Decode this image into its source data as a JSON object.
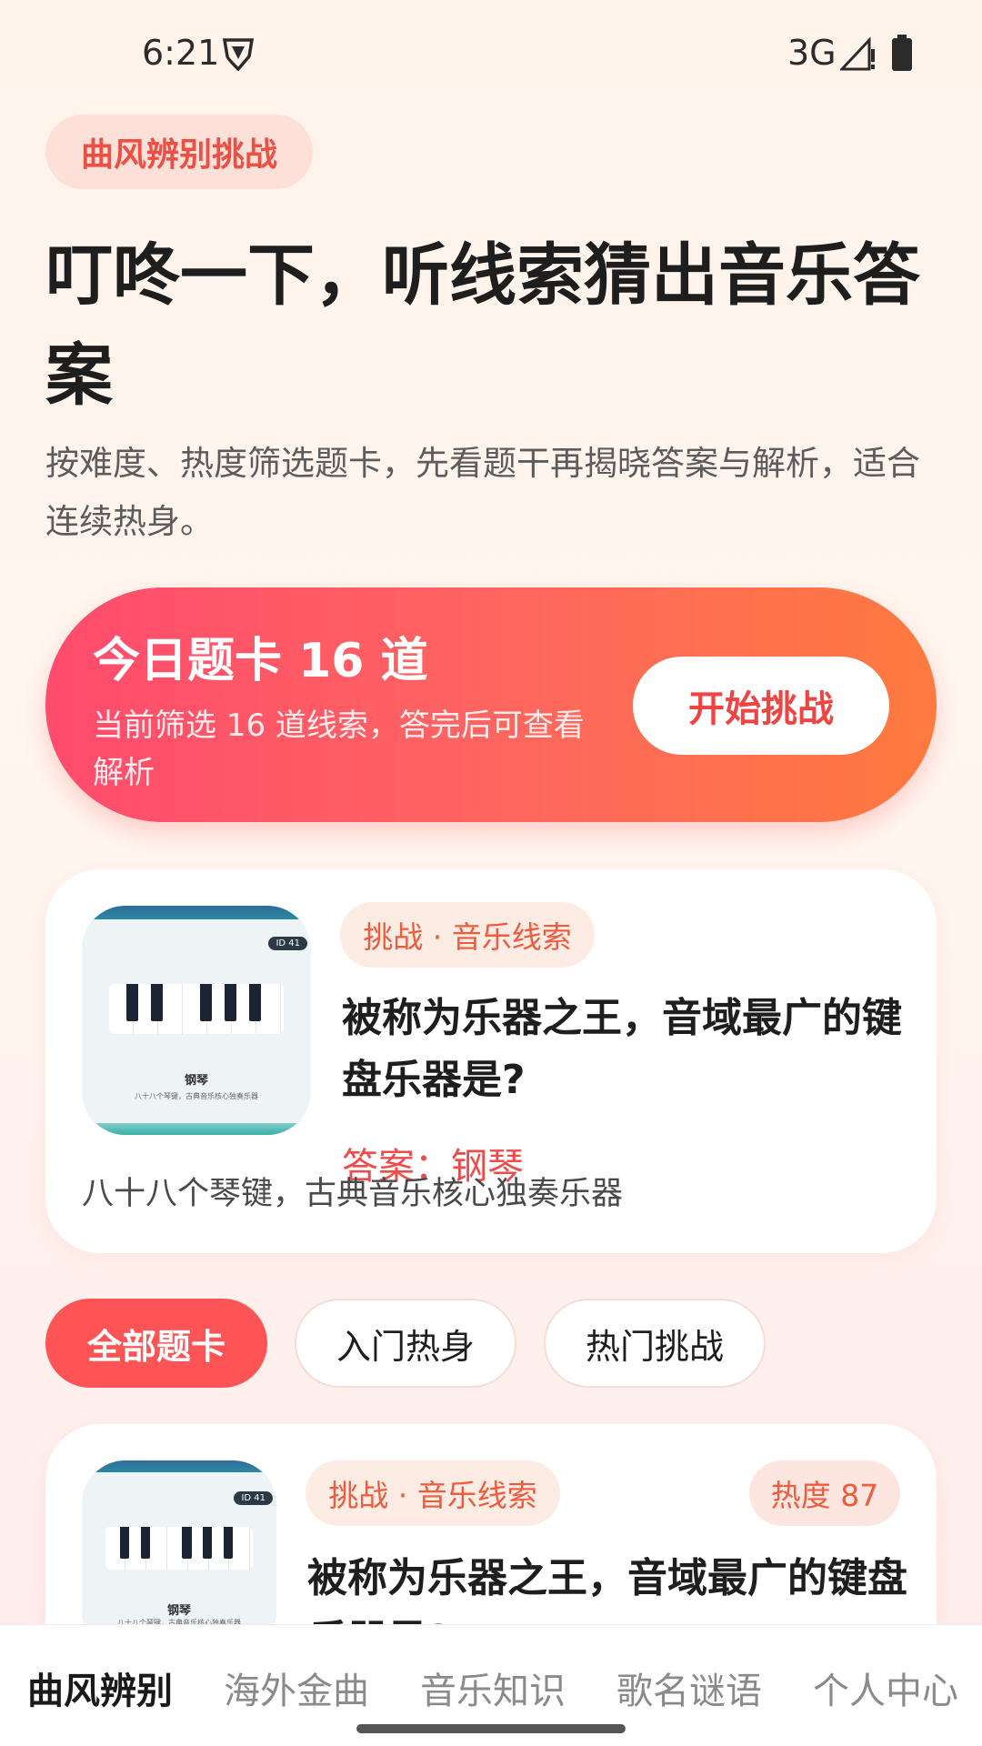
{
  "status_bar": {
    "time": "6:21",
    "network": "3G"
  },
  "header": {
    "pill": "曲风辨别挑战",
    "headline": "叮咚一下，听线索猜出音乐答案",
    "subtitle": "按难度、热度筛选题卡，先看题干再揭晓答案与解析，适合连续热身。"
  },
  "hero": {
    "title": "今日题卡 16 道",
    "desc": "当前筛选 16 道线索，答完后可查看解析",
    "button": "开始挑战"
  },
  "featured_card": {
    "image_id": "ID 41",
    "image_caption": "钢琴",
    "image_subcaption": "八十八个琴键，古典音乐核心独奏乐器",
    "tag": "挑战 · 音乐线索",
    "question": "被称为乐器之王，音域最广的键盘乐器是?",
    "answer": "答案：钢琴",
    "explanation": "八十八个琴键，古典音乐核心独奏乐器"
  },
  "filters": [
    "全部题卡",
    "入门热身",
    "热门挑战"
  ],
  "list_card": {
    "image_id": "ID 41",
    "image_caption": "钢琴",
    "image_subcaption": "八十八个琴键，古典音乐核心独奏乐器",
    "tag": "挑战 · 音乐线索",
    "heat": "热度 87",
    "question": "被称为乐器之王，音域最广的键盘乐器是?"
  },
  "bottom_nav": [
    "曲风辨别",
    "海外金曲",
    "音乐知识",
    "歌名谜语",
    "个人中心"
  ],
  "colors": {
    "accent": "#ff5456",
    "gradient_start": "#ff4b6e",
    "gradient_end": "#ff7a3f"
  }
}
